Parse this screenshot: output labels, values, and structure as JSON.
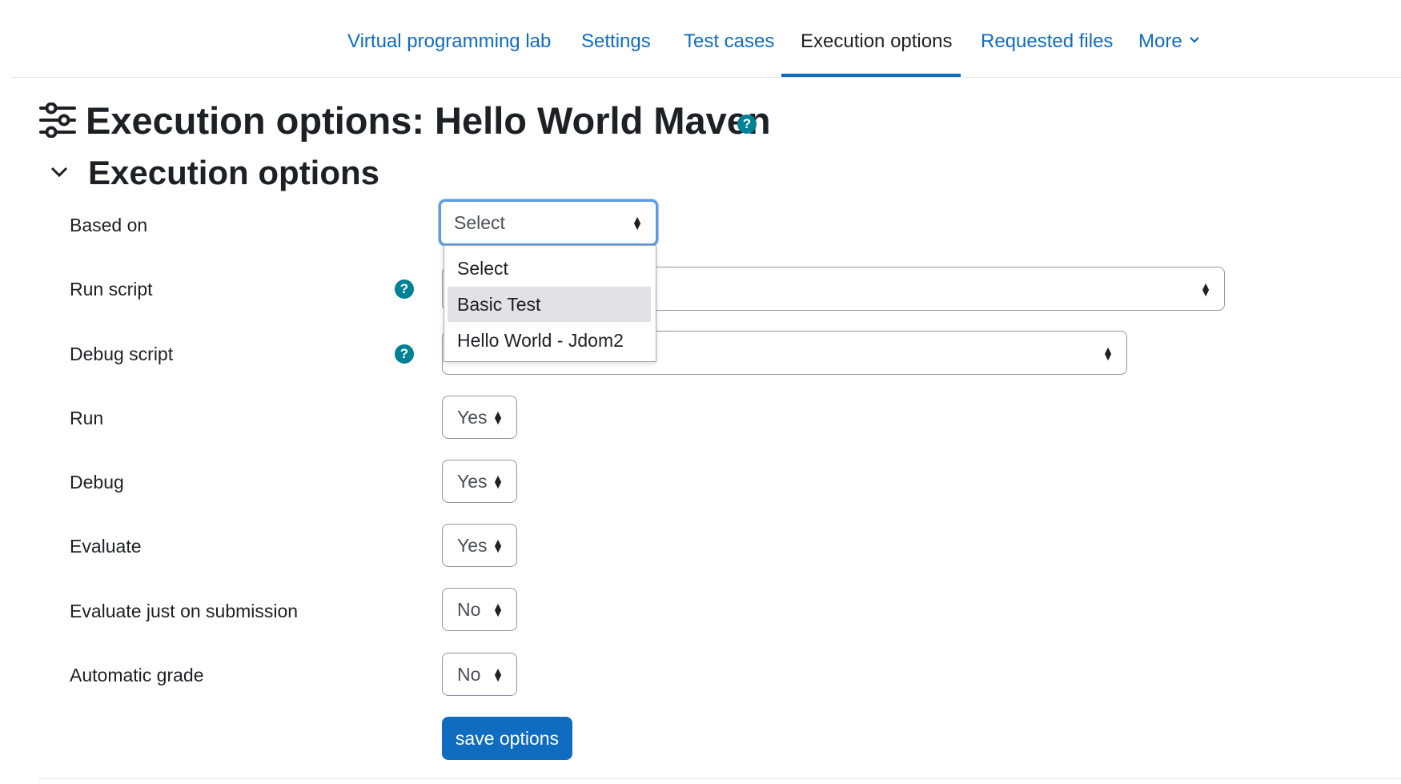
{
  "nav": {
    "items": [
      {
        "label": "Virtual programming lab"
      },
      {
        "label": "Settings"
      },
      {
        "label": "Test cases"
      },
      {
        "label": "Execution options",
        "active": true
      },
      {
        "label": "Requested files"
      },
      {
        "label": "More"
      }
    ]
  },
  "page": {
    "title": "Execution options: Hello World Maven",
    "section_heading": "Execution options",
    "help_glyph": "?"
  },
  "form": {
    "based_on": {
      "label": "Based on",
      "value": "Select"
    },
    "based_on_options": [
      "Select",
      "Basic Test",
      "Hello World - Jdom2"
    ],
    "highlighted_option": "Basic Test",
    "run_script": {
      "label": "Run script",
      "value": ""
    },
    "debug_script": {
      "label": "Debug script",
      "value": ""
    },
    "run": {
      "label": "Run",
      "value": "Yes"
    },
    "debug": {
      "label": "Debug",
      "value": "Yes"
    },
    "evaluate": {
      "label": "Evaluate",
      "value": "Yes"
    },
    "evaluate_just_on_submission": {
      "label": "Evaluate just on submission",
      "value": "No"
    },
    "automatic_grade": {
      "label": "Automatic grade",
      "value": "No"
    },
    "save_label": "save options"
  },
  "colors": {
    "link": "#0f6cbf",
    "help_icon": "#008196",
    "button": "#0f6cbf",
    "focus_ring": "#5b9be0"
  },
  "icons": [
    "sliders-icon",
    "help-icon",
    "chevron-down-icon",
    "select-arrows-icon"
  ]
}
